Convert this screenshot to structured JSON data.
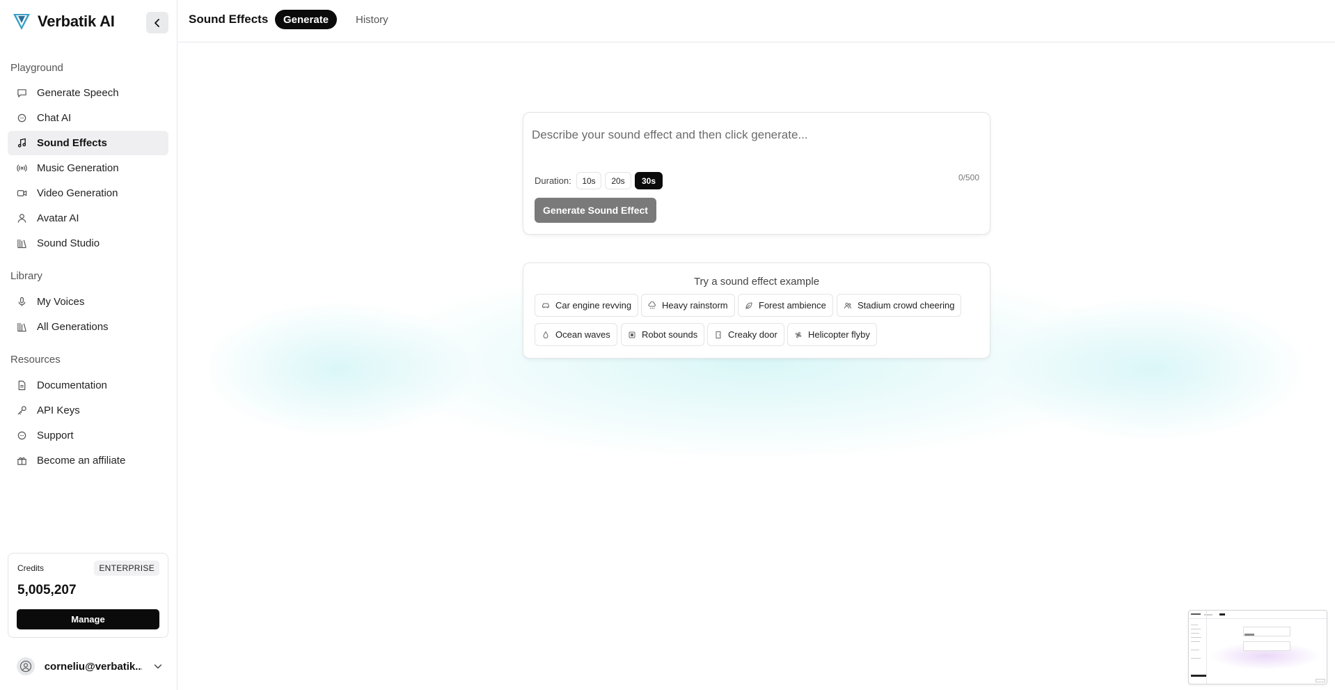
{
  "brand": {
    "name": "Verbatik AI"
  },
  "sidebar": {
    "sections": [
      {
        "label": "Playground"
      },
      {
        "label": "Library"
      },
      {
        "label": "Resources"
      }
    ],
    "items": [
      {
        "label": "Generate Speech",
        "icon": "message-square-icon"
      },
      {
        "label": "Chat AI",
        "icon": "message-circle-icon"
      },
      {
        "label": "Sound Effects",
        "icon": "music-note-icon",
        "active": true
      },
      {
        "label": "Music Generation",
        "icon": "radio-icon"
      },
      {
        "label": "Video Generation",
        "icon": "video-icon"
      },
      {
        "label": "Avatar AI",
        "icon": "user-icon"
      },
      {
        "label": "Sound Studio",
        "icon": "library-icon"
      },
      {
        "label": "My Voices",
        "icon": "microphone-icon"
      },
      {
        "label": "All Generations",
        "icon": "library-icon"
      },
      {
        "label": "Documentation",
        "icon": "document-icon"
      },
      {
        "label": "API Keys",
        "icon": "key-icon"
      },
      {
        "label": "Support",
        "icon": "message-circle-icon"
      },
      {
        "label": "Become an affiliate",
        "icon": "gift-icon"
      }
    ]
  },
  "credits": {
    "label": "Credits",
    "tier": "ENTERPRISE",
    "amount": "5,005,207",
    "manage_label": "Manage"
  },
  "user": {
    "email": "corneliu@verbatik...."
  },
  "header": {
    "title": "Sound Effects",
    "tabs": [
      {
        "label": "Generate",
        "active": true
      },
      {
        "label": "History",
        "active": false
      }
    ]
  },
  "prompt": {
    "placeholder": "Describe your sound effect and then click generate...",
    "value": "",
    "duration_label": "Duration:",
    "durations": [
      "10s",
      "20s",
      "30s"
    ],
    "selected_duration": "30s",
    "counter": "0/500",
    "generate_label": "Generate Sound Effect"
  },
  "examples": {
    "title": "Try a sound effect example",
    "items": [
      {
        "label": "Car engine revving",
        "icon": "car-icon"
      },
      {
        "label": "Heavy rainstorm",
        "icon": "cloud-rain-icon"
      },
      {
        "label": "Forest ambience",
        "icon": "leaf-icon"
      },
      {
        "label": "Stadium crowd cheering",
        "icon": "users-icon"
      },
      {
        "label": "Ocean waves",
        "icon": "droplet-icon"
      },
      {
        "label": "Robot sounds",
        "icon": "robot-icon"
      },
      {
        "label": "Creaky door",
        "icon": "door-icon"
      },
      {
        "label": "Helicopter flyby",
        "icon": "fan-icon"
      }
    ]
  },
  "colors": {
    "accent": "#0b0b0b",
    "disabled_button": "#7a7a7a",
    "glow": "#b4eef0"
  }
}
